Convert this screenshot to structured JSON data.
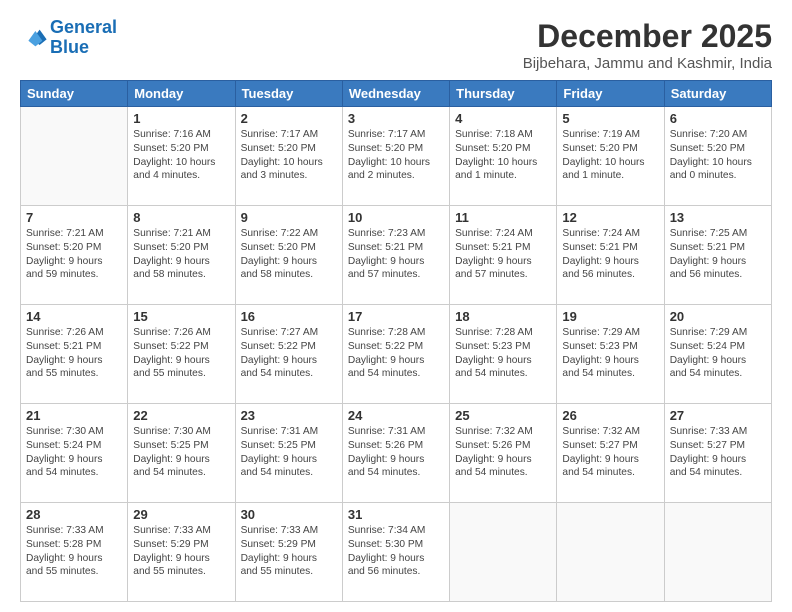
{
  "logo": {
    "line1": "General",
    "line2": "Blue"
  },
  "title": "December 2025",
  "location": "Bijbehara, Jammu and Kashmir, India",
  "headers": [
    "Sunday",
    "Monday",
    "Tuesday",
    "Wednesday",
    "Thursday",
    "Friday",
    "Saturday"
  ],
  "weeks": [
    [
      {
        "day": "",
        "text": ""
      },
      {
        "day": "1",
        "text": "Sunrise: 7:16 AM\nSunset: 5:20 PM\nDaylight: 10 hours\nand 4 minutes."
      },
      {
        "day": "2",
        "text": "Sunrise: 7:17 AM\nSunset: 5:20 PM\nDaylight: 10 hours\nand 3 minutes."
      },
      {
        "day": "3",
        "text": "Sunrise: 7:17 AM\nSunset: 5:20 PM\nDaylight: 10 hours\nand 2 minutes."
      },
      {
        "day": "4",
        "text": "Sunrise: 7:18 AM\nSunset: 5:20 PM\nDaylight: 10 hours\nand 1 minute."
      },
      {
        "day": "5",
        "text": "Sunrise: 7:19 AM\nSunset: 5:20 PM\nDaylight: 10 hours\nand 1 minute."
      },
      {
        "day": "6",
        "text": "Sunrise: 7:20 AM\nSunset: 5:20 PM\nDaylight: 10 hours\nand 0 minutes."
      }
    ],
    [
      {
        "day": "7",
        "text": "Sunrise: 7:21 AM\nSunset: 5:20 PM\nDaylight: 9 hours\nand 59 minutes."
      },
      {
        "day": "8",
        "text": "Sunrise: 7:21 AM\nSunset: 5:20 PM\nDaylight: 9 hours\nand 58 minutes."
      },
      {
        "day": "9",
        "text": "Sunrise: 7:22 AM\nSunset: 5:20 PM\nDaylight: 9 hours\nand 58 minutes."
      },
      {
        "day": "10",
        "text": "Sunrise: 7:23 AM\nSunset: 5:21 PM\nDaylight: 9 hours\nand 57 minutes."
      },
      {
        "day": "11",
        "text": "Sunrise: 7:24 AM\nSunset: 5:21 PM\nDaylight: 9 hours\nand 57 minutes."
      },
      {
        "day": "12",
        "text": "Sunrise: 7:24 AM\nSunset: 5:21 PM\nDaylight: 9 hours\nand 56 minutes."
      },
      {
        "day": "13",
        "text": "Sunrise: 7:25 AM\nSunset: 5:21 PM\nDaylight: 9 hours\nand 56 minutes."
      }
    ],
    [
      {
        "day": "14",
        "text": "Sunrise: 7:26 AM\nSunset: 5:21 PM\nDaylight: 9 hours\nand 55 minutes."
      },
      {
        "day": "15",
        "text": "Sunrise: 7:26 AM\nSunset: 5:22 PM\nDaylight: 9 hours\nand 55 minutes."
      },
      {
        "day": "16",
        "text": "Sunrise: 7:27 AM\nSunset: 5:22 PM\nDaylight: 9 hours\nand 54 minutes."
      },
      {
        "day": "17",
        "text": "Sunrise: 7:28 AM\nSunset: 5:22 PM\nDaylight: 9 hours\nand 54 minutes."
      },
      {
        "day": "18",
        "text": "Sunrise: 7:28 AM\nSunset: 5:23 PM\nDaylight: 9 hours\nand 54 minutes."
      },
      {
        "day": "19",
        "text": "Sunrise: 7:29 AM\nSunset: 5:23 PM\nDaylight: 9 hours\nand 54 minutes."
      },
      {
        "day": "20",
        "text": "Sunrise: 7:29 AM\nSunset: 5:24 PM\nDaylight: 9 hours\nand 54 minutes."
      }
    ],
    [
      {
        "day": "21",
        "text": "Sunrise: 7:30 AM\nSunset: 5:24 PM\nDaylight: 9 hours\nand 54 minutes."
      },
      {
        "day": "22",
        "text": "Sunrise: 7:30 AM\nSunset: 5:25 PM\nDaylight: 9 hours\nand 54 minutes."
      },
      {
        "day": "23",
        "text": "Sunrise: 7:31 AM\nSunset: 5:25 PM\nDaylight: 9 hours\nand 54 minutes."
      },
      {
        "day": "24",
        "text": "Sunrise: 7:31 AM\nSunset: 5:26 PM\nDaylight: 9 hours\nand 54 minutes."
      },
      {
        "day": "25",
        "text": "Sunrise: 7:32 AM\nSunset: 5:26 PM\nDaylight: 9 hours\nand 54 minutes."
      },
      {
        "day": "26",
        "text": "Sunrise: 7:32 AM\nSunset: 5:27 PM\nDaylight: 9 hours\nand 54 minutes."
      },
      {
        "day": "27",
        "text": "Sunrise: 7:33 AM\nSunset: 5:27 PM\nDaylight: 9 hours\nand 54 minutes."
      }
    ],
    [
      {
        "day": "28",
        "text": "Sunrise: 7:33 AM\nSunset: 5:28 PM\nDaylight: 9 hours\nand 55 minutes."
      },
      {
        "day": "29",
        "text": "Sunrise: 7:33 AM\nSunset: 5:29 PM\nDaylight: 9 hours\nand 55 minutes."
      },
      {
        "day": "30",
        "text": "Sunrise: 7:33 AM\nSunset: 5:29 PM\nDaylight: 9 hours\nand 55 minutes."
      },
      {
        "day": "31",
        "text": "Sunrise: 7:34 AM\nSunset: 5:30 PM\nDaylight: 9 hours\nand 56 minutes."
      },
      {
        "day": "",
        "text": ""
      },
      {
        "day": "",
        "text": ""
      },
      {
        "day": "",
        "text": ""
      }
    ]
  ]
}
